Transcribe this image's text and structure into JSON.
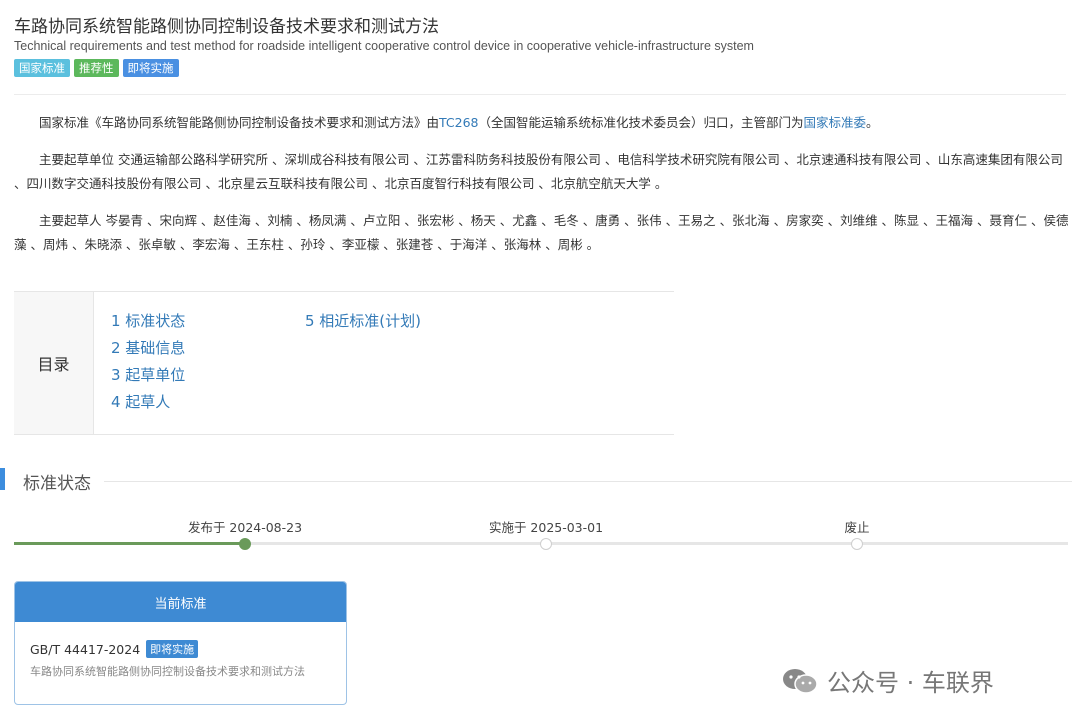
{
  "header": {
    "title": "车路协同系统智能路侧协同控制设备技术要求和测试方法",
    "subtitle": "Technical requirements and test method for roadside intelligent cooperative control device in cooperative vehicle-infrastructure system",
    "badges": [
      "国家标准",
      "推荐性",
      "即将实施"
    ]
  },
  "intro": {
    "p1_pre": "国家标准《车路协同系统智能路侧协同控制设备技术要求和测试方法》由",
    "p1_link1": "TC268",
    "p1_mid": "（全国智能运输系统标准化技术委员会）归口，主管部门为",
    "p1_link2": "国家标准委",
    "p1_post": "。",
    "p2": "主要起草单位 交通运输部公路科学研究所 、深圳成谷科技有限公司 、江苏雷科防务科技股份有限公司 、电信科学技术研究院有限公司 、北京速通科技有限公司 、山东高速集团有限公司 、四川数字交通科技股份有限公司 、北京星云互联科技有限公司 、北京百度智行科技有限公司 、北京航空航天大学 。",
    "p3": "主要起草人 岑晏青 、宋向辉 、赵佳海 、刘楠 、杨凤满 、卢立阳 、张宏彬 、杨天 、尤鑫 、毛冬 、唐勇 、张伟 、王易之 、张北海 、房家奕 、刘维维 、陈显 、王福海 、聂育仁 、侯德藻 、周炜 、朱晓添 、张卓敏 、李宏海 、王东柱 、孙玲 、李亚檬 、张建苍 、于海洋 、张海林 、周彬 。"
  },
  "toc": {
    "label": "目录",
    "items": [
      "1  标准状态",
      "2  基础信息",
      "3  起草单位",
      "4  起草人",
      "5  相近标准(计划)"
    ]
  },
  "status_section": {
    "title": "标准状态",
    "timeline": {
      "published": "发布于 2024-08-23",
      "implemented": "实施于 2025-03-01",
      "abolished": "废止"
    }
  },
  "current_card": {
    "header": "当前标准",
    "code": "GB/T 44417-2024",
    "badge": "即将实施",
    "desc": "车路协同系统智能路侧协同控制设备技术要求和测试方法"
  },
  "watermark": {
    "text": "公众号 · 车联界"
  },
  "colors": {
    "link": "#337ab7",
    "accent": "#3e8ad3",
    "badge_cyan": "#5bc0de",
    "badge_green": "#5cb85c",
    "timeline_done": "#6a9a5a"
  }
}
